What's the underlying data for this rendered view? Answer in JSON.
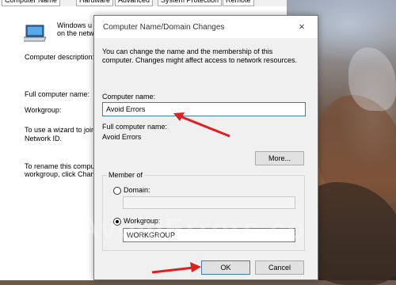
{
  "system_window": {
    "tabs": [
      "Computer Name",
      "Hardware",
      "Advanced",
      "System Protection",
      "Remote"
    ],
    "info_line1": "Windows u",
    "info_line2": "on the netw",
    "computer_description_label": "Computer description:",
    "full_computer_name_label": "Full computer name:",
    "workgroup_label": "Workgroup:",
    "wizard_line1": "To use a wizard to join",
    "wizard_line2": "Network ID.",
    "rename_line1": "To rename this comput",
    "rename_line2": "workgroup, click Chan"
  },
  "dialog": {
    "title": "Computer Name/Domain Changes",
    "close_icon": "×",
    "description_line1": "You can change the name and the membership of this",
    "description_line2": "computer. Changes might affect access to network resources.",
    "computer_name_label": "Computer name:",
    "computer_name_value": "Avoid Errors",
    "full_computer_name_label": "Full computer name:",
    "full_computer_name_value": "Avoid Errors",
    "more_button": "More...",
    "member_of_label": "Member of",
    "domain_label": "Domain:",
    "domain_value": "",
    "workgroup_label": "Workgroup:",
    "workgroup_value": "WORKGROUP",
    "selected_membership": "workgroup",
    "ok_button": "OK",
    "cancel_button": "Cancel"
  },
  "watermark": "AvoidErrors.co",
  "colors": {
    "arrow": "#e02020",
    "focus_border": "#3c7fb1",
    "dialog_bg": "#f0f0f0"
  },
  "icons": [
    "computer-icon",
    "close-icon",
    "annotation-arrow-icon"
  ]
}
